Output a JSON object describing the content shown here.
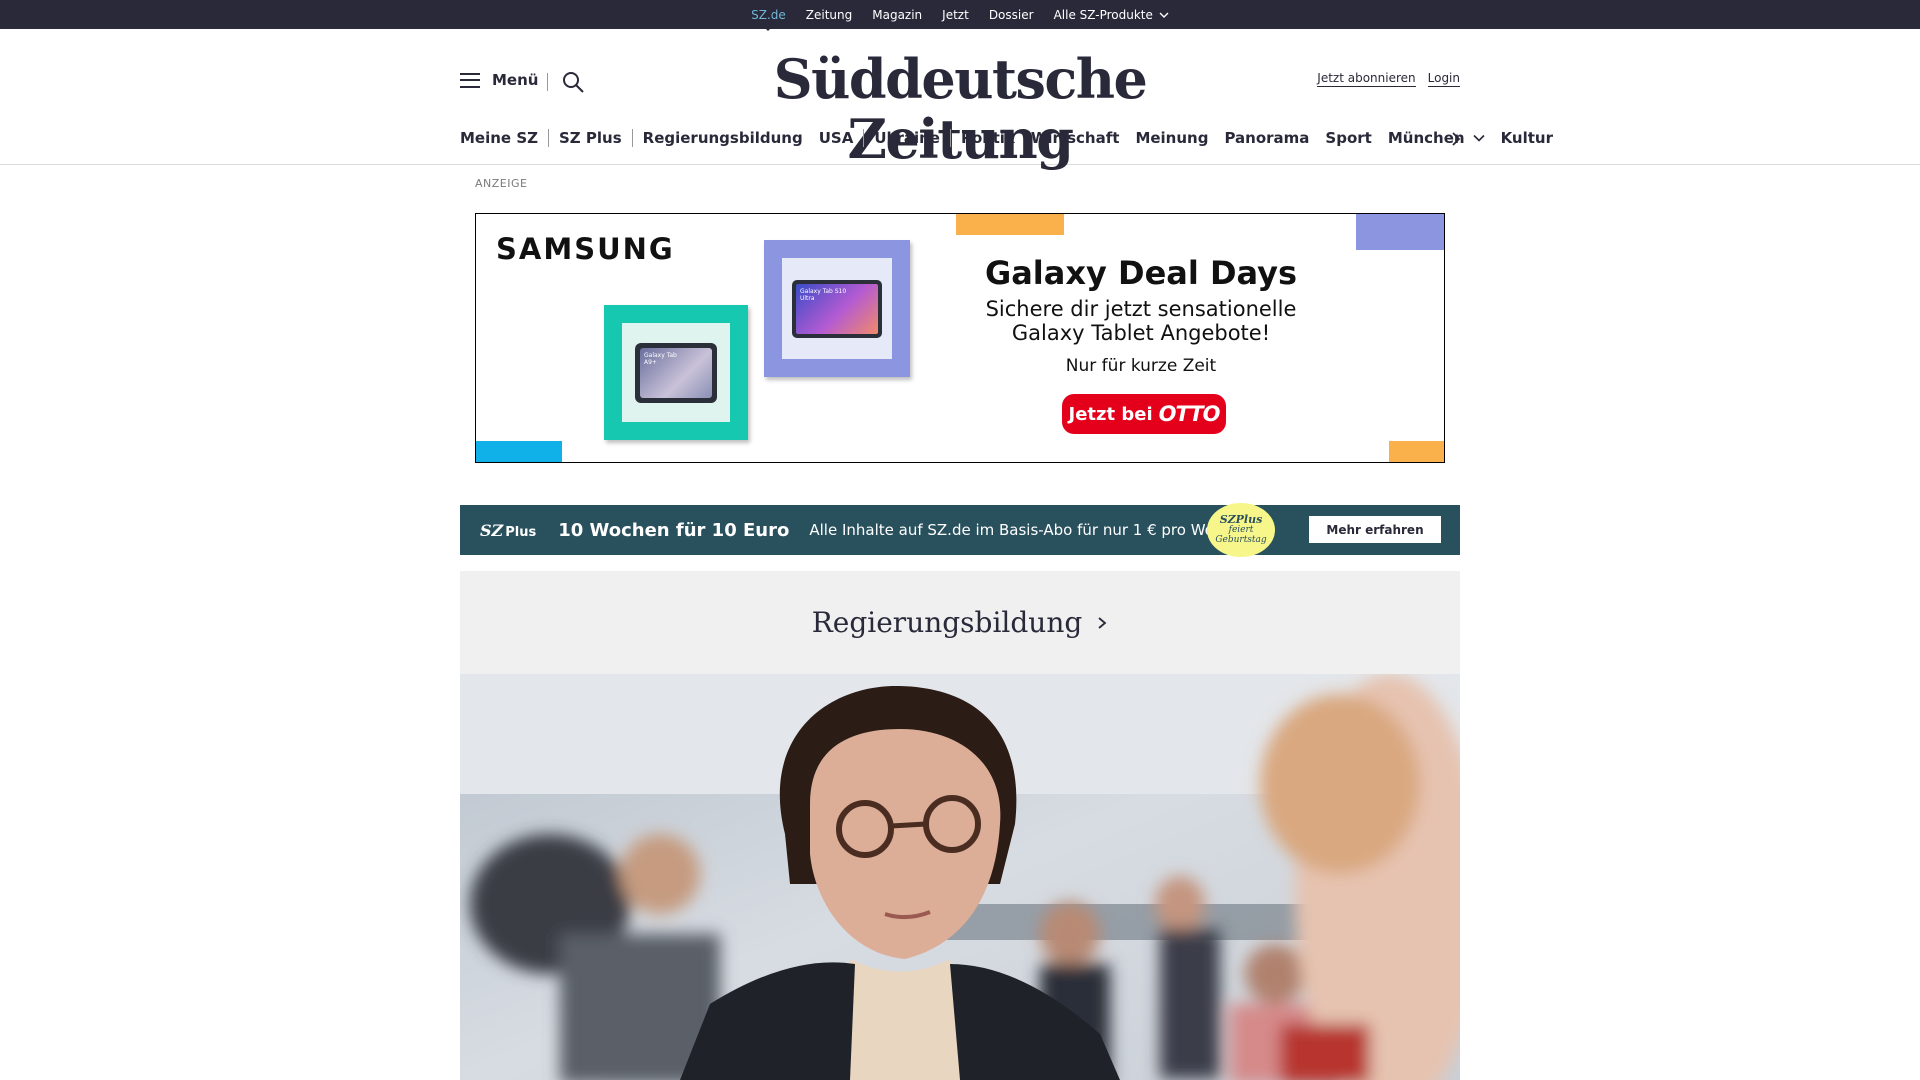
{
  "topbar": {
    "items": [
      {
        "label": "SZ.de",
        "active": true
      },
      {
        "label": "Zeitung"
      },
      {
        "label": "Magazin"
      },
      {
        "label": "Jetzt"
      },
      {
        "label": "Dossier"
      },
      {
        "label": "Alle SZ-Produkte",
        "icon": "chevron-down-icon"
      }
    ]
  },
  "header": {
    "menu_label": "Menü",
    "logo": "Süddeutsche Zeitung",
    "subscribe": "Jetzt abonnieren",
    "login": "Login"
  },
  "nav": {
    "items": [
      "Meine SZ",
      "SZ Plus",
      "Regierungsbildung",
      "USA",
      "Ukraine",
      "Politik",
      "Wirtschaft",
      "Meinung",
      "Panorama",
      "Sport",
      "München",
      "Kultur"
    ]
  },
  "ad": {
    "label": "ANZEIGE",
    "brand": "SAMSUNG",
    "tablet1": "Galaxy Tab A9+",
    "tablet2": "Galaxy Tab S10 Ultra",
    "headline": "Galaxy Deal Days",
    "subline1": "Sichere dir jetzt sensationelle",
    "subline2": "Galaxy Tablet Angebote!",
    "small": "Nur für kurze Zeit",
    "cta_prefix": "Jetzt bei",
    "cta_brand": "OTTO"
  },
  "promo": {
    "logo_sz": "SZ",
    "logo_plus": "Plus",
    "headline": "10 Wochen für 10 Euro",
    "text": "Alle Inhalte auf SZ.de im Basis-Abo für nur 1 € pro Woche.",
    "badge_top": "SZPlus",
    "badge_line1": "feiert",
    "badge_line2": "Geburtstag",
    "button": "Mehr erfahren"
  },
  "section": {
    "title": "Regierungsbildung"
  },
  "colors": {
    "dark": "#29293a",
    "promo_bg": "#29505d",
    "section_bg": "#f0f0f0",
    "otto_red": "#e4001b",
    "active_link": "#71b6d6"
  }
}
